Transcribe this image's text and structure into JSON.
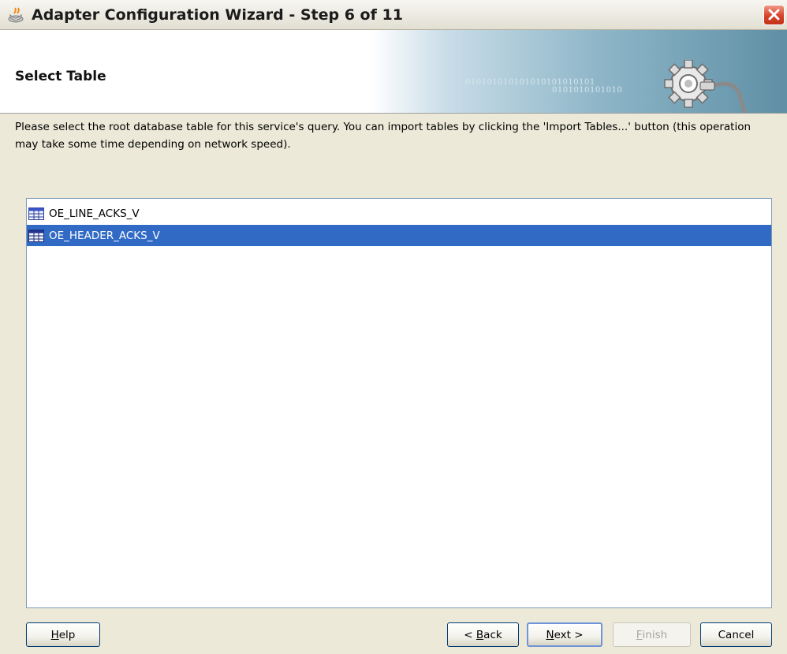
{
  "window": {
    "title": "Adapter Configuration Wizard - Step 6 of 11"
  },
  "header": {
    "title": "Select Table",
    "binary_line1": "010101010101010101010101",
    "binary_line2": "0101010101010"
  },
  "description": "Please select the root database table for this service's query.  You can import tables by clicking the 'Import Tables...' button (this operation may take some time depending on network speed).",
  "tables": [
    {
      "name": "OE_LINE_ACKS_V",
      "selected": false
    },
    {
      "name": "OE_HEADER_ACKS_V",
      "selected": true
    }
  ],
  "buttons": {
    "help": {
      "pre": "",
      "mnemonic": "H",
      "post": "elp"
    },
    "back": {
      "pre": "< ",
      "mnemonic": "B",
      "post": "ack"
    },
    "next": {
      "pre": "",
      "mnemonic": "N",
      "post": "ext >"
    },
    "finish": {
      "pre": "",
      "mnemonic": "F",
      "post": "inish",
      "enabled": false
    },
    "cancel": {
      "label": "Cancel"
    }
  },
  "colors": {
    "selection": "#316ac5",
    "close_button": "#d6412a"
  }
}
